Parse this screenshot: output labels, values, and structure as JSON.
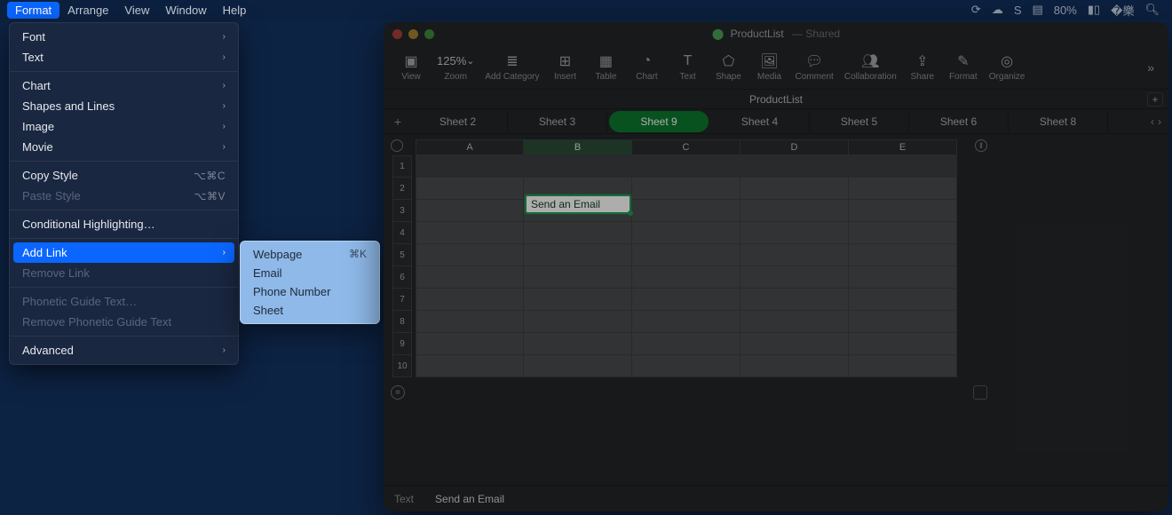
{
  "menubar": {
    "items": [
      "Format",
      "Arrange",
      "View",
      "Window",
      "Help"
    ],
    "selected_index": 0,
    "battery": "80%"
  },
  "format_menu": {
    "font": "Font",
    "text": "Text",
    "chart": "Chart",
    "shapes": "Shapes and Lines",
    "image": "Image",
    "movie": "Movie",
    "copy_style": "Copy Style",
    "copy_style_sc": "⌥⌘C",
    "paste_style": "Paste Style",
    "paste_style_sc": "⌥⌘V",
    "conditional": "Conditional Highlighting…",
    "add_link": "Add Link",
    "remove_link": "Remove Link",
    "phonetic": "Phonetic Guide Text…",
    "remove_phonetic": "Remove Phonetic Guide Text",
    "advanced": "Advanced"
  },
  "submenu": {
    "webpage": "Webpage",
    "webpage_sc": "⌘K",
    "email": "Email",
    "phone": "Phone Number",
    "sheet": "Sheet"
  },
  "window": {
    "title": "ProductList",
    "shared": "Shared",
    "docname": "ProductList"
  },
  "toolbar": {
    "view": "View",
    "zoom": "Zoom",
    "zoom_val": "125%",
    "addcat": "Add Category",
    "insert": "Insert",
    "table": "Table",
    "chart": "Chart",
    "text": "Text",
    "shape": "Shape",
    "media": "Media",
    "comment": "Comment",
    "collab": "Collaboration",
    "share": "Share",
    "format": "Format",
    "organize": "Organize"
  },
  "sheets": [
    "Sheet 2",
    "Sheet 3",
    "Sheet 9",
    "Sheet 4",
    "Sheet 5",
    "Sheet 6",
    "Sheet 8"
  ],
  "active_sheet_index": 2,
  "columns": [
    "A",
    "B",
    "C",
    "D",
    "E"
  ],
  "rows": [
    "1",
    "2",
    "3",
    "4",
    "5",
    "6",
    "7",
    "8",
    "9",
    "10"
  ],
  "cell_edit": {
    "value": "Send an Email"
  },
  "formula_bar": {
    "label": "Text",
    "value": "Send an Email"
  }
}
